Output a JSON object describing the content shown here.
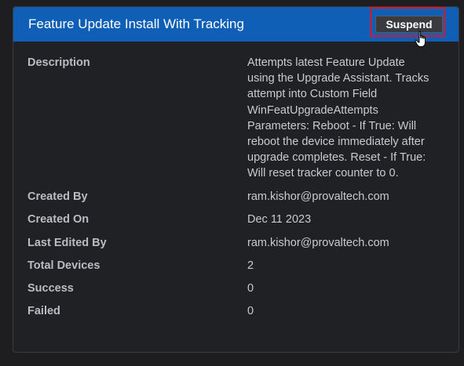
{
  "panel": {
    "title": "Feature Update Install With Tracking",
    "suspend_label": "Suspend"
  },
  "details": {
    "description_label": "Description",
    "description_lines": [
      "Attempts latest Feature Update",
      "using the Upgrade Assistant. Tracks",
      "attempt into Custom Field",
      "WinFeatUpgradeAttempts",
      "Parameters: Reboot - If True: Will",
      "reboot the device immediately after",
      "upgrade completes. Reset - If True:",
      "Will reset tracker counter to 0."
    ],
    "created_by_label": "Created By",
    "created_by": "ram.kishor@provaltech.com",
    "created_on_label": "Created On",
    "created_on": "Dec 11 2023",
    "last_edited_by_label": "Last Edited By",
    "last_edited_by": "ram.kishor@provaltech.com",
    "total_devices_label": "Total Devices",
    "total_devices": "2",
    "success_label": "Success",
    "success": "0",
    "failed_label": "Failed",
    "failed": "0"
  },
  "colors": {
    "header": "#0f5fb6",
    "highlight": "#d8182a"
  },
  "icons": {
    "cursor": "hand-pointer-icon"
  }
}
